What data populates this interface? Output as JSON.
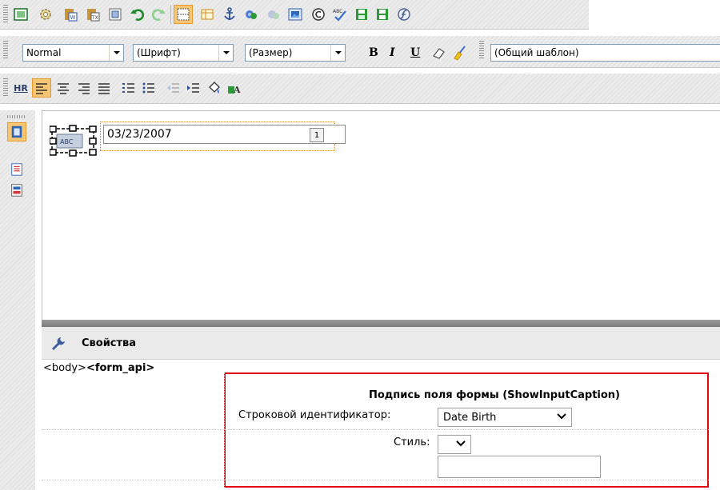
{
  "toolbar_main": {
    "icons": [
      "toggle-view-icon",
      "settings-gear-icon",
      "paste-word-icon",
      "paste-text-icon",
      "select-all-icon",
      "undo-icon",
      "redo-icon",
      "show-borders-icon",
      "table-icon",
      "anchor-icon",
      "link-icon",
      "unlink-icon",
      "image-icon",
      "copyright-icon",
      "spellcheck-icon",
      "save-template-icon",
      "save-icon",
      "flash-icon"
    ]
  },
  "toolbar_format": {
    "style_value": "Normal",
    "font_value": "(Шрифт)",
    "size_value": "(Размер)",
    "bold_label": "B",
    "italic_label": "I",
    "underline_label": "U",
    "template_value": "(Общий шаблон)"
  },
  "toolbar_paragraph": {
    "hr_label": "HR"
  },
  "editor": {
    "date_value": "03/23/2007",
    "calendar_label": "1",
    "widget_label": "ABC"
  },
  "properties": {
    "title": "Свойства",
    "path_body": "<body>",
    "path_form": "<form_api>",
    "caption_title": "Подпись поля формы (ShowInputCaption)",
    "string_id_label": "Строковой идентификатор:",
    "string_id_value": "Date Birth",
    "style_label": "Стиль:",
    "style_value": ""
  },
  "colors": {
    "active_button": "#f7c675",
    "highlight_border": "#e3000f",
    "selection_dots": "#e0861b"
  }
}
